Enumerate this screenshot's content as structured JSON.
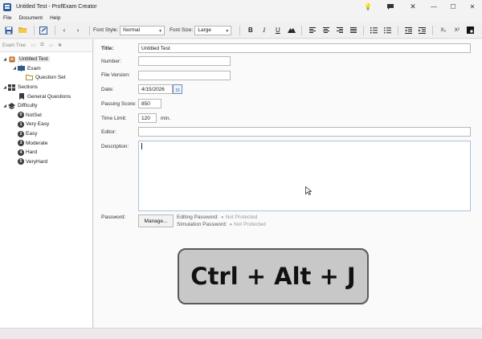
{
  "window": {
    "title": "Untitled Test - ProfExam Creator"
  },
  "menu": [
    "File",
    "Document",
    "Help"
  ],
  "toolbar": {
    "font_style_label": "Font Style:",
    "font_style_value": "Normal",
    "font_size_label": "Font Size:",
    "font_size_value": "Large",
    "bold": "B",
    "italic": "I",
    "underline": "U",
    "subscript": "X₂",
    "superscript": "X²"
  },
  "tree": {
    "header": "Exam Tree",
    "items": [
      {
        "label": "Untitled Test",
        "level": 0,
        "icon": "test-icon"
      },
      {
        "label": "Exam",
        "level": 1,
        "icon": "exam-icon"
      },
      {
        "label": "Question Set",
        "level": 2,
        "icon": "folder-icon"
      },
      {
        "label": "Sections",
        "level": 0,
        "icon": "sections-icon"
      },
      {
        "label": "General Questions",
        "level": 1,
        "icon": "bookmark-icon"
      },
      {
        "label": "Difficulty",
        "level": 0,
        "icon": "difficulty-icon"
      },
      {
        "label": "NotSet",
        "level": 1,
        "badge": "0"
      },
      {
        "label": "Very Easy",
        "level": 1,
        "badge": "1"
      },
      {
        "label": "Easy",
        "level": 1,
        "badge": "2"
      },
      {
        "label": "Moderate",
        "level": 1,
        "badge": "3"
      },
      {
        "label": "Hard",
        "level": 1,
        "badge": "4"
      },
      {
        "label": "VeryHard",
        "level": 1,
        "badge": "5"
      }
    ]
  },
  "form": {
    "title_label": "Title:",
    "title_value": "Untitled Test",
    "number_label": "Number:",
    "number_value": "",
    "file_version_label": "File Version:",
    "file_version_value": "",
    "date_label": "Date:",
    "date_value": "4/15/2026",
    "calendar_day": "15",
    "passing_score_label": "Passing Score:",
    "passing_score_value": "850",
    "time_limit_label": "Time Limit:",
    "time_limit_value": "120",
    "time_limit_unit": "min.",
    "editor_label": "Editor:",
    "editor_value": "",
    "description_label": "Description:",
    "password_label": "Password:",
    "manage_button": "Manage...",
    "editing_password_label": "Editing Password:",
    "editing_password_status": "Not Protected",
    "simulation_password_label": "Simulation Password:",
    "simulation_password_status": "Not Protected"
  },
  "overlay": {
    "shortcut": "Ctrl + Alt + J"
  },
  "colors": {
    "accent": "#2b5a9a",
    "overlay_bg": "#c8c8c8",
    "overlay_border": "#5a5a5a"
  }
}
